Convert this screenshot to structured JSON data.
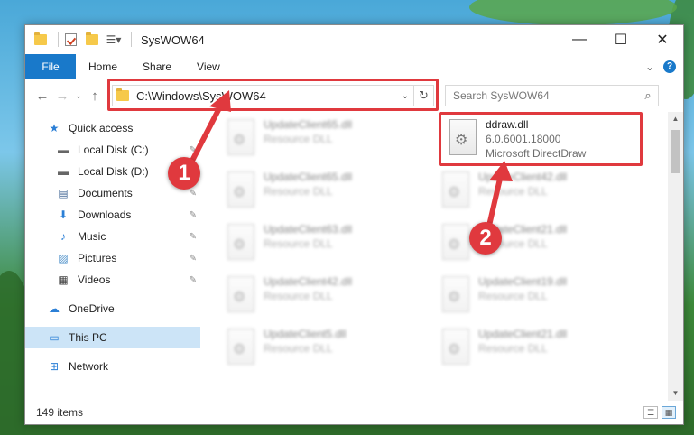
{
  "window": {
    "title": "SysWOW64"
  },
  "window_controls": {
    "minimize": "—",
    "maximize": "☐",
    "close": "✕"
  },
  "ribbon": {
    "tabs": [
      "File",
      "Home",
      "Share",
      "View"
    ],
    "expand": "⌄",
    "help": "?"
  },
  "navigation": {
    "back": "←",
    "forward": "→",
    "recent": "⌄",
    "up": "↑"
  },
  "address": {
    "path": "C:\\Windows\\SysWOW64",
    "dropdown": "⌄",
    "refresh": "↻"
  },
  "search": {
    "placeholder": "Search SysWOW64",
    "icon": "⌕"
  },
  "sidebar": {
    "items": [
      {
        "label": "Quick access",
        "icon": "★"
      },
      {
        "label": "Local Disk (C:)",
        "icon": "▬",
        "pinned": true
      },
      {
        "label": "Local Disk (D:)",
        "icon": "▬"
      },
      {
        "label": "Documents",
        "icon": "▤",
        "pinned": true
      },
      {
        "label": "Downloads",
        "icon": "⬇",
        "pinned": true
      },
      {
        "label": "Music",
        "icon": "♪",
        "pinned": true
      },
      {
        "label": "Pictures",
        "icon": "▨",
        "pinned": true
      },
      {
        "label": "Videos",
        "icon": "▦",
        "pinned": true
      },
      {
        "label": "OneDrive",
        "icon": "☁"
      },
      {
        "label": "This PC",
        "icon": "▭"
      },
      {
        "label": "Network",
        "icon": "⊞"
      }
    ],
    "pin_icon": "📌"
  },
  "files": [
    {
      "name": "UpdateClient65.dll",
      "type": "Resource DLL"
    },
    {
      "name": "ddraw.dll",
      "version": "6.0.6001.18000",
      "type": "Microsoft DirectDraw"
    },
    {
      "name": "UpdateClient65.dll",
      "type": "Resource DLL"
    },
    {
      "name": "UpdateClient42.dll",
      "type": "Resource DLL"
    },
    {
      "name": "UpdateClient63.dll",
      "type": "Resource DLL"
    },
    {
      "name": "UpdateClient21.dll",
      "type": "Resource DLL"
    },
    {
      "name": "UpdateClient42.dll",
      "type": "Resource DLL"
    },
    {
      "name": "UpdateClient19.dll",
      "type": "Resource DLL"
    },
    {
      "name": "UpdateClient5.dll",
      "type": "Resource DLL"
    },
    {
      "name": "UpdateClient21.dll",
      "type": "Resource DLL"
    }
  ],
  "status": {
    "item_count": "149 items"
  },
  "annotations": {
    "step1": "1",
    "step2": "2",
    "color": "#e0393e"
  }
}
